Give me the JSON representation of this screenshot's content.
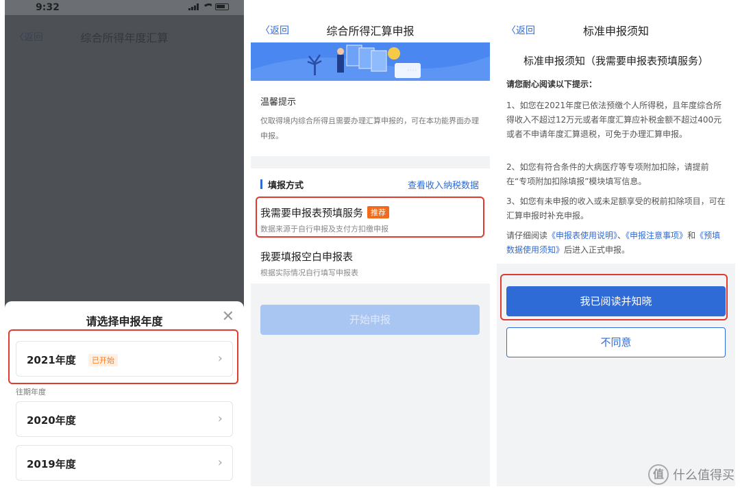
{
  "panel1": {
    "status_time": "9:32",
    "nav": {
      "back_label": "〈返回",
      "title": "综合所得年度汇算"
    },
    "sheet": {
      "title": "请选择申报年度",
      "close_icon": "✕",
      "current_year": {
        "label": "2021年度",
        "badge": "已开始"
      },
      "past_label": "往期年度",
      "past_years": [
        {
          "label": "2020年度"
        },
        {
          "label": "2019年度"
        }
      ]
    }
  },
  "panel2": {
    "nav": {
      "back_label": "〈返回",
      "title": "综合所得汇算申报"
    },
    "tips": {
      "title": "温馨提示",
      "body": "仅取得境内综合所得且需要办理汇算申报的，可在本功能界面办理申报。"
    },
    "method": {
      "section_title": "填报方式",
      "link": "查看收入纳税数据",
      "options": [
        {
          "title": "我需要申报表预填服务",
          "badge": "推荐",
          "subtitle": "数据来源于自行申报及支付方扣缴申报"
        },
        {
          "title": "我要填报空白申报表",
          "subtitle": "根据实际情况自行填写申报表"
        }
      ]
    },
    "start_button": "开始申报"
  },
  "panel3": {
    "nav": {
      "back_label": "〈返回",
      "title": "标准申报须知"
    },
    "heading": "标准申报须知（我需要申报表预填服务）",
    "subheading": "请您耐心阅读以下提示：",
    "para1": "1、如您在2021年度已依法预缴个人所得税，且年度综合所得收入不超过12万元或者年度汇算应补税金额不超过400元或者不申请年度汇算退税，可免于办理汇算申报。",
    "para2": "2、如您有符合条件的大病医疗等专项附加扣除，请提前在“专项附加扣除填报”模块填写信息。",
    "para3": "3、如您有未申报的收入或未足额享受的税前扣除项目，可在汇算申报时补充申报。",
    "para4": {
      "prefix": "请仔细阅读",
      "link1": "《申报表使用说明》",
      "sep1": "、",
      "link2": "《申报注意事项》",
      "sep2": "和",
      "link3": "《预填数据使用须知》",
      "suffix": "后进入正式申报。"
    },
    "agree_button": "我已阅读并知晓",
    "disagree_button": "不同意"
  },
  "watermark": {
    "logo_char": "值",
    "text": "什么值得买"
  },
  "colors": {
    "accent": "#2f6bd6",
    "highlight": "#e03a2e",
    "badge_orange": "#f26a1b"
  }
}
